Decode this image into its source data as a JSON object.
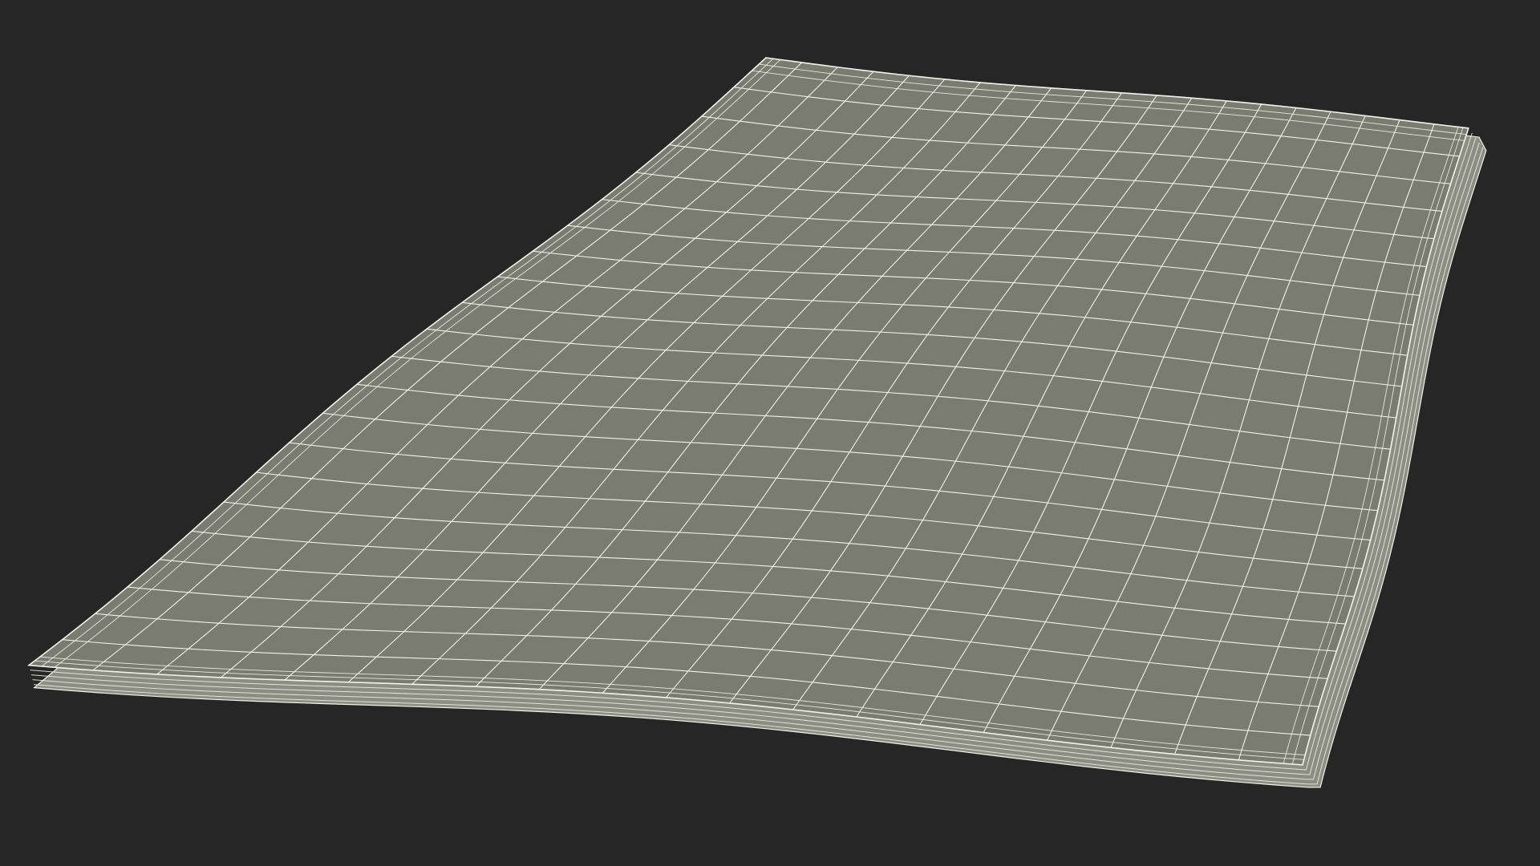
{
  "scene": {
    "background_color": "#262626",
    "surface_color": "#7a7b71",
    "edge_color": "#8c8d83",
    "wire_color": "#f2f2e8",
    "grid_columns": 20,
    "grid_rows": 22
  }
}
